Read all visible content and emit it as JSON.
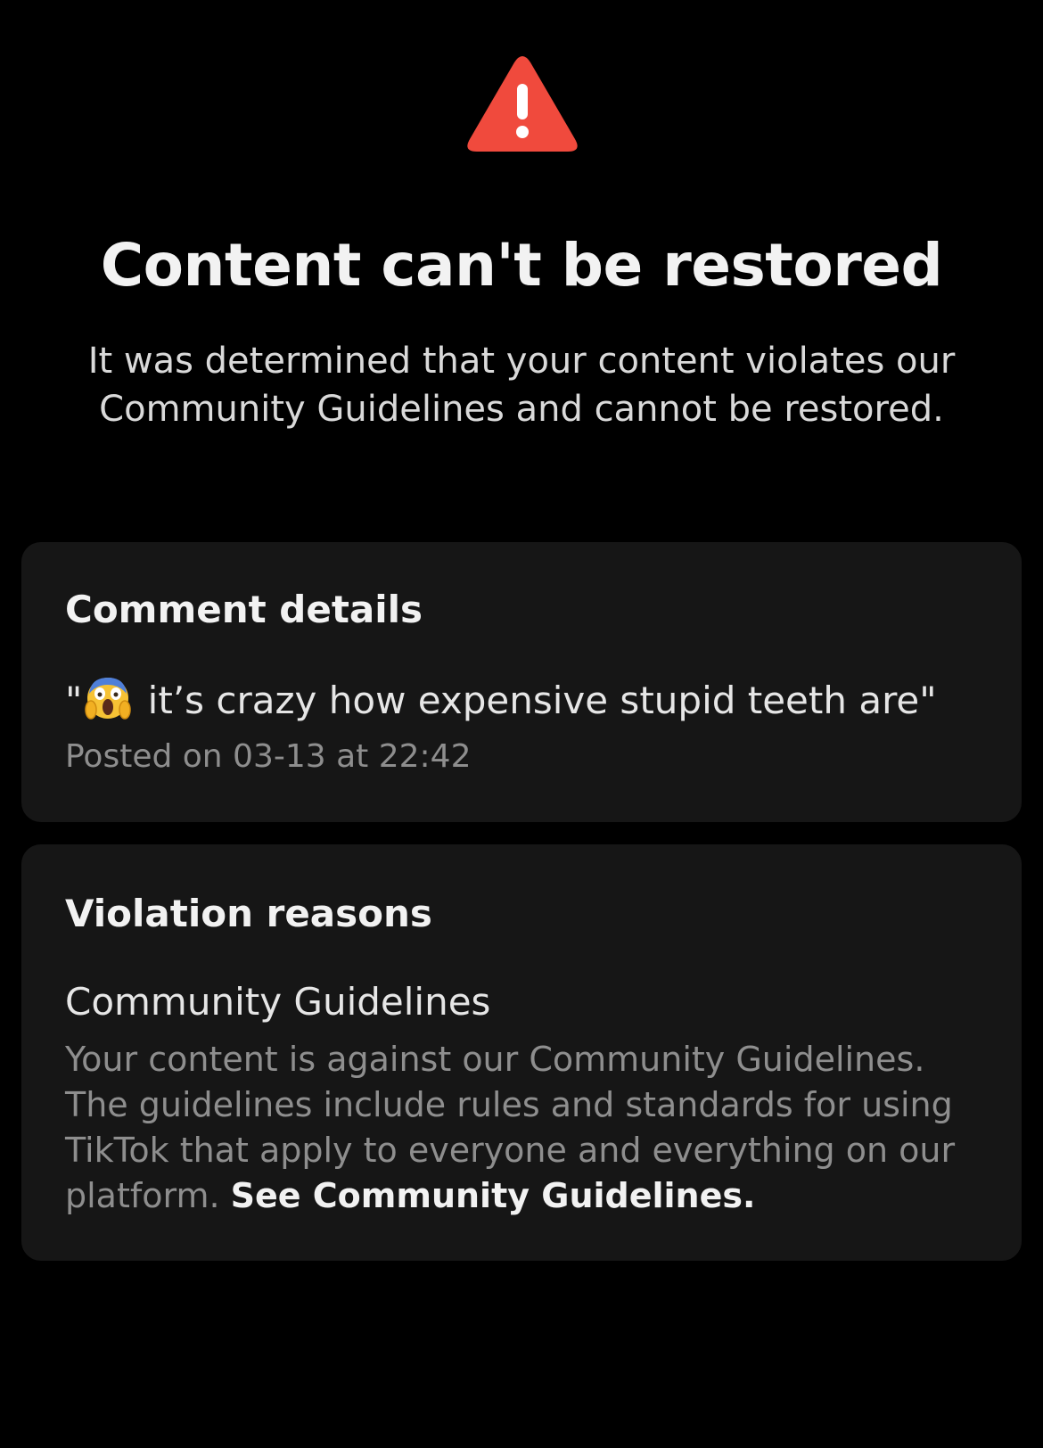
{
  "colors": {
    "background": "#000000",
    "card": "#161616",
    "warning_accent": "#f04a3d",
    "primary_text": "#f2f2f2",
    "secondary_text": "#8e8e8e"
  },
  "header": {
    "icon": "warning-triangle-icon",
    "title": "Content can't be restored",
    "subtitle": "It was determined that your content violates our Community Guidelines and cannot be restored."
  },
  "comment_details": {
    "heading": "Comment details",
    "quote_open": "\"",
    "emoji": "screaming-face-emoji",
    "comment_text": " it’s crazy how expensive stupid teeth are\"",
    "posted": "Posted on 03-13 at 22:42"
  },
  "violation_reasons": {
    "heading": "Violation reasons",
    "reason_title": "Community Guidelines",
    "reason_desc": "Your content is against our Community Guidelines. The guidelines include rules and standards for using TikTok that apply to everyone and everything on our platform. ",
    "link_label": "See Community Guidelines."
  }
}
